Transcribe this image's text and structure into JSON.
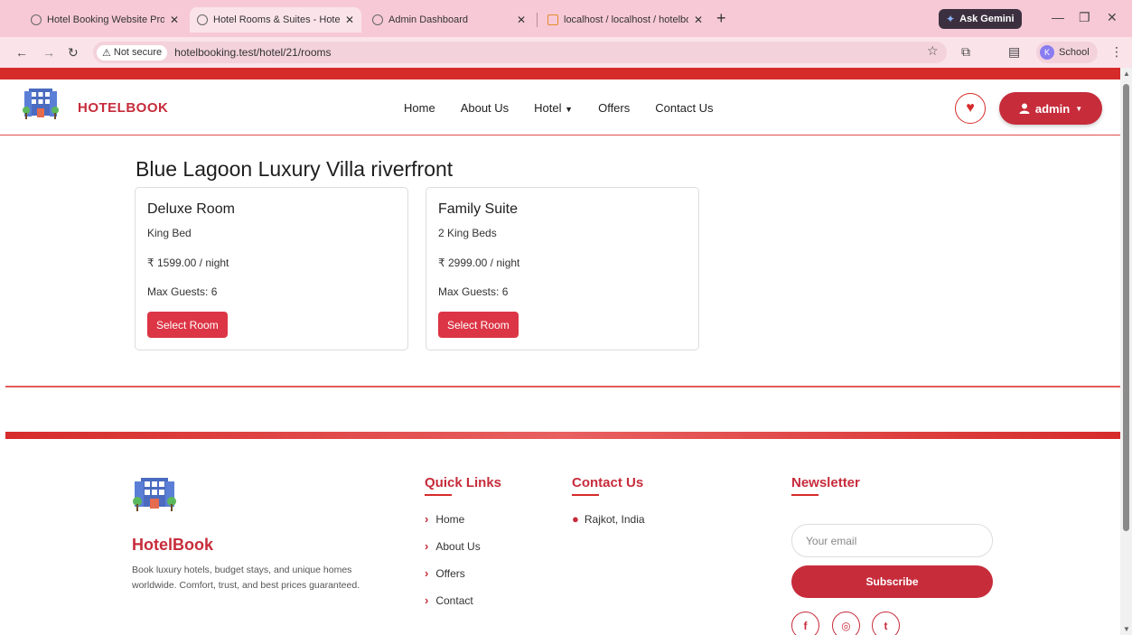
{
  "browser": {
    "tabs": [
      {
        "label": "Hotel Booking Website Project",
        "close": "✕"
      },
      {
        "label": "Hotel Rooms & Suites - HotelB",
        "close": "✕"
      },
      {
        "label": "Admin Dashboard",
        "close": "✕"
      },
      {
        "label": "localhost / localhost / hotelboo",
        "close": "✕"
      }
    ],
    "new_tab": "+",
    "ask_gemini": "Ask Gemini",
    "security_label": "Not secure",
    "url": "hotelbooking.test/hotel/21/rooms",
    "profile_initial": "K",
    "profile_name": "School"
  },
  "site": {
    "brand": "HOTELBOOK",
    "nav": [
      "Home",
      "About Us",
      "Hotel",
      "Offers",
      "Contact Us"
    ],
    "user_label": "admin"
  },
  "hotel": {
    "name": "Blue Lagoon Luxury Villa riverfront",
    "rooms": [
      {
        "title": "Deluxe Room",
        "bed": "King Bed",
        "price": "₹ 1599.00 / night",
        "guests": "Max Guests: 6",
        "button": "Select Room"
      },
      {
        "title": "Family Suite",
        "bed": "2 King Beds",
        "price": "₹ 2999.00 / night",
        "guests": "Max Guests: 6",
        "button": "Select Room"
      }
    ]
  },
  "footer": {
    "brand": "HotelBook",
    "description": "Book luxury hotels, budget stays, and unique homes worldwide. Comfort, trust, and best prices guaranteed.",
    "quick_links_title": "Quick Links",
    "quick_links": [
      "Home",
      "About Us",
      "Offers",
      "Contact"
    ],
    "contact_title": "Contact Us",
    "contact_location": "Rajkot, India",
    "newsletter_title": "Newsletter",
    "email_placeholder": "Your email",
    "subscribe_label": "Subscribe",
    "social": [
      "facebook-icon",
      "instagram-icon",
      "twitter-icon"
    ]
  },
  "colors": {
    "brand_red": "#c72c3b",
    "button_red": "#dc3545",
    "chrome_pink": "#f7c9d6"
  }
}
